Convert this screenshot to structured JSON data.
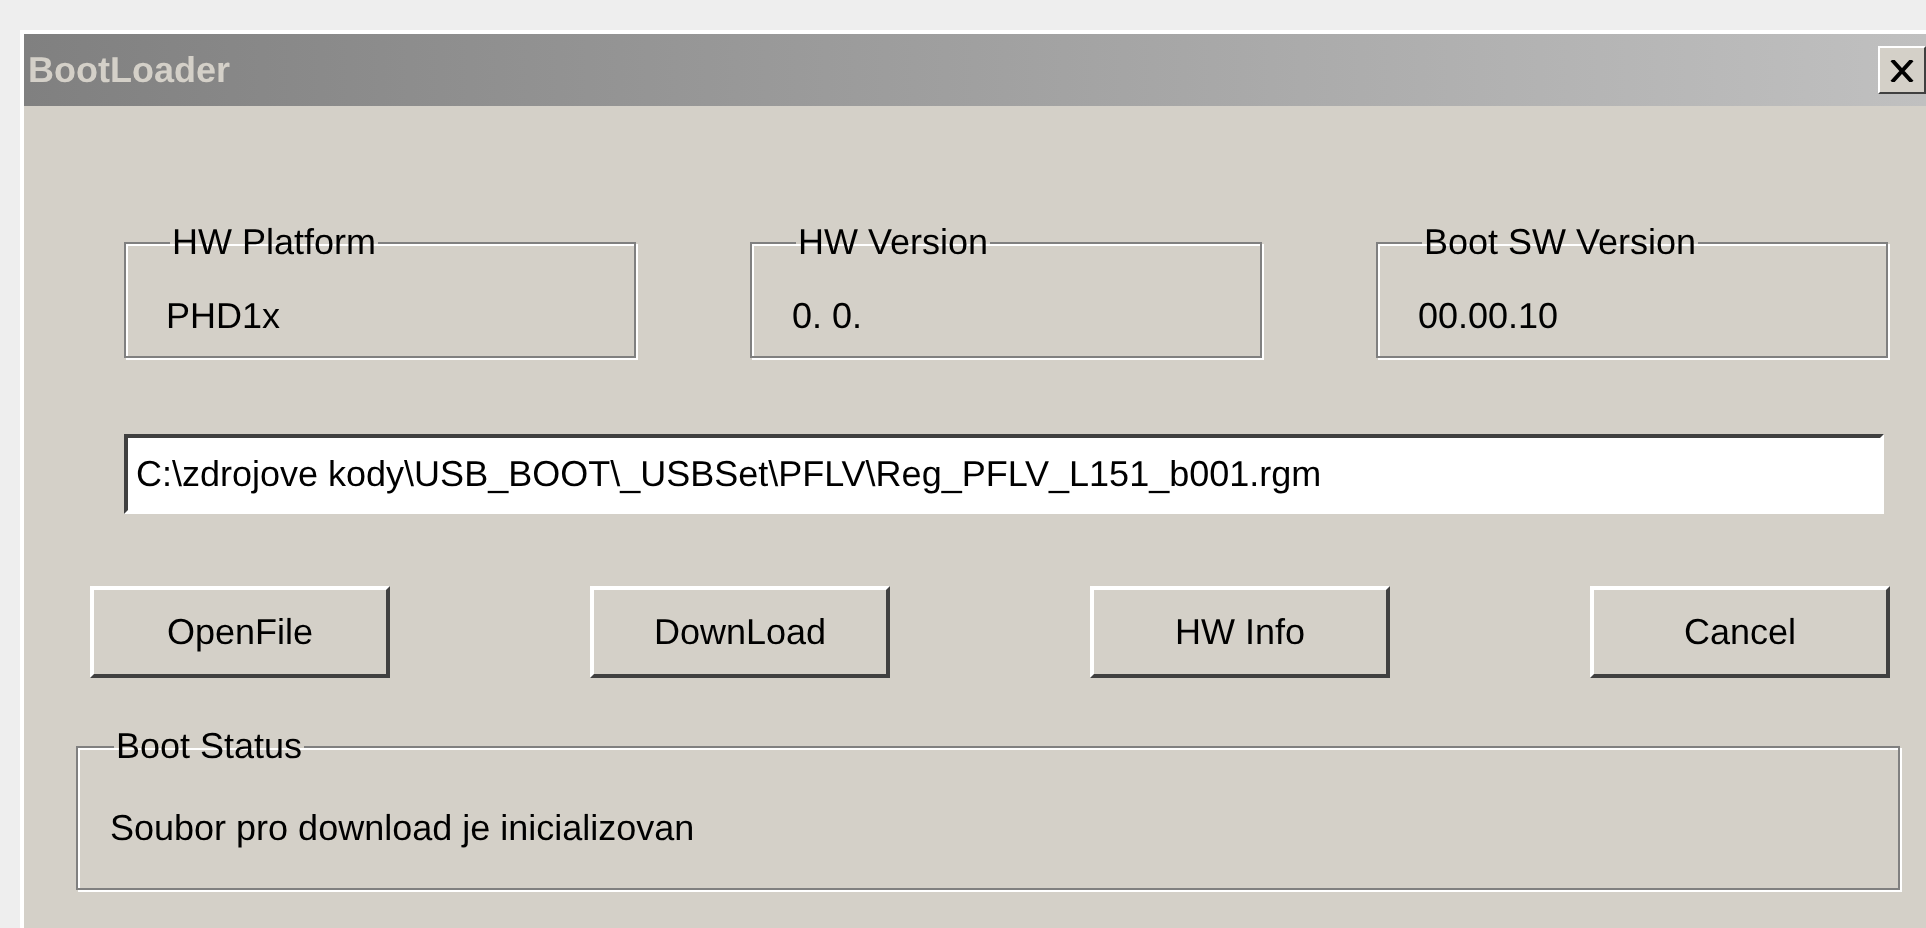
{
  "window": {
    "title": "BootLoader"
  },
  "info_groups": [
    {
      "label": "HW Platform",
      "value": "PHD1x"
    },
    {
      "label": "HW Version",
      "value": "0. 0."
    },
    {
      "label": "Boot SW Version",
      "value": "00.00.10"
    }
  ],
  "file_path": {
    "value": "C:\\zdrojove kody\\USB_BOOT\\_USBSet\\PFLV\\Reg_PFLV_L151_b001.rgm"
  },
  "buttons": [
    "OpenFile",
    "DownLoad",
    "HW Info",
    "Cancel"
  ],
  "boot_status": {
    "label": "Boot Status",
    "message": "Soubor pro download je inicializovan"
  }
}
